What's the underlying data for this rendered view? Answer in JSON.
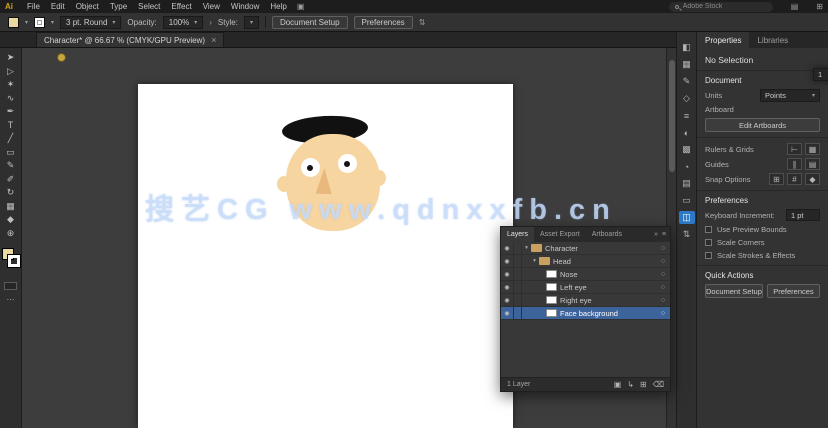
{
  "icons": {
    "caret": "▾",
    "chevron_right": "›",
    "eye": "◉",
    "target": "○",
    "disclosure": "▾",
    "arrange": "▣",
    "workspace": "▤",
    "app_grid": "⊞",
    "swap": "⇅"
  },
  "menubar": {
    "logo": "Ai",
    "items": [
      "File",
      "Edit",
      "Object",
      "Type",
      "Select",
      "Effect",
      "View",
      "Window",
      "Help"
    ],
    "search_text": "Adobe Stock"
  },
  "control_bar": {
    "brush": "3 pt. Round",
    "opacity_label": "Opacity:",
    "opacity_value": "100%",
    "style_label": "Style:",
    "document_setup": "Document Setup",
    "preferences": "Preferences"
  },
  "document_tab": {
    "title": "Character* @ 66.67 % (CMYK/GPU Preview)",
    "close": "×"
  },
  "toolbar": {
    "fill_color": "#ead9a0",
    "tools": [
      {
        "name": "selection-tool-icon",
        "glyph": "➤"
      },
      {
        "name": "direct-selection-tool-icon",
        "glyph": "▷"
      },
      {
        "name": "magic-wand-tool-icon",
        "glyph": "✶"
      },
      {
        "name": "lasso-tool-icon",
        "glyph": "∿"
      },
      {
        "name": "pen-tool-icon",
        "glyph": "✒"
      },
      {
        "name": "type-tool-icon",
        "glyph": "T"
      },
      {
        "name": "line-segment-tool-icon",
        "glyph": "╱"
      },
      {
        "name": "rectangle-tool-icon",
        "glyph": "▭"
      },
      {
        "name": "paintbrush-tool-icon",
        "glyph": "✎"
      },
      {
        "name": "pencil-tool-icon",
        "glyph": "✐"
      },
      {
        "name": "rotate-tool-icon",
        "glyph": "↻"
      },
      {
        "name": "mesh-tool-icon",
        "glyph": "▦"
      },
      {
        "name": "eyedropper-tool-icon",
        "glyph": "◆"
      },
      {
        "name": "zoom-tool-icon",
        "glyph": "⊕"
      }
    ]
  },
  "canvas": {
    "watermark": "搜艺CG  www.qdnxxfb.cn"
  },
  "character": {
    "hat_color": "#111111",
    "skin_color": "#f7d5a1",
    "nose_color": "#e8b87c",
    "eye_white": "#ffffff",
    "pupil_color": "#151515"
  },
  "right_strip": {
    "icons": [
      {
        "name": "color-panel-icon",
        "glyph": "◧"
      },
      {
        "name": "swatches-panel-icon",
        "glyph": "▦"
      },
      {
        "name": "brushes-panel-icon",
        "glyph": "✎"
      },
      {
        "name": "symbols-panel-icon",
        "glyph": "◇"
      },
      {
        "name": "stroke-panel-icon",
        "glyph": "≡"
      },
      {
        "name": "gradient-panel-icon",
        "glyph": "◐"
      },
      {
        "name": "transparency-panel-icon",
        "glyph": "▩"
      },
      {
        "name": "appearance-panel-icon",
        "glyph": "◔"
      },
      {
        "name": "graphic-styles-panel-icon",
        "glyph": "▤"
      },
      {
        "name": "artboards-panel-icon",
        "glyph": "▭"
      },
      {
        "name": "layers-panel-icon",
        "glyph": "◫",
        "active": true
      },
      {
        "name": "asset-export-panel-icon",
        "glyph": "⇅"
      }
    ]
  },
  "layers_panel": {
    "tabs": [
      "Layers",
      "Asset Export",
      "Artboards"
    ],
    "collapse_icon": "»",
    "menu_icon": "≡",
    "rows": [
      {
        "name": "Character"
      },
      {
        "name": "Head"
      },
      {
        "name": "Nose"
      },
      {
        "name": "Left eye"
      },
      {
        "name": "Right eye"
      },
      {
        "name": "Face background",
        "selected": true
      }
    ],
    "status": "1 Layer",
    "footer_icons": [
      {
        "name": "make-clipping-mask-icon",
        "glyph": "▣"
      },
      {
        "name": "new-sublayer-icon",
        "glyph": "↳"
      },
      {
        "name": "new-layer-icon",
        "glyph": "⊞"
      },
      {
        "name": "delete-layer-icon",
        "glyph": "⌫"
      }
    ],
    "selection_color": "#3d639b"
  },
  "properties_panel": {
    "tabs": [
      "Properties",
      "Libraries"
    ],
    "no_selection": "No Selection",
    "document": {
      "title": "Document",
      "units_label": "Units",
      "units_value": "Points",
      "artboard_label": "Artboard",
      "artboard_value": "1",
      "edit_artboards": "Edit Artboards"
    },
    "toggles": {
      "rulers_label": "Rulers & Grids",
      "rulers_icons": [
        {
          "name": "show-rulers-icon",
          "glyph": "⊢"
        },
        {
          "name": "show-grid-icon",
          "glyph": "▦"
        }
      ],
      "guides_label": "Guides",
      "guides_icons": [
        {
          "name": "show-guides-icon",
          "glyph": "∥"
        },
        {
          "name": "lock-guides-icon",
          "glyph": "▤"
        }
      ],
      "snap_label": "Snap Options",
      "snap_icons": [
        {
          "name": "snap-to-grid-icon",
          "glyph": "⊞"
        },
        {
          "name": "snap-to-pixel-icon",
          "glyph": "#"
        },
        {
          "name": "snap-to-point-icon",
          "glyph": "◆"
        }
      ]
    },
    "preferences": {
      "title": "Preferences",
      "increment_label": "Keyboard Increment:",
      "increment_value": "1 pt",
      "checkboxes": [
        "Use Preview Bounds",
        "Scale Corners",
        "Scale Strokes & Effects"
      ]
    },
    "quick_actions": {
      "title": "Quick Actions",
      "document_setup": "Document Setup",
      "preferences": "Preferences"
    }
  }
}
